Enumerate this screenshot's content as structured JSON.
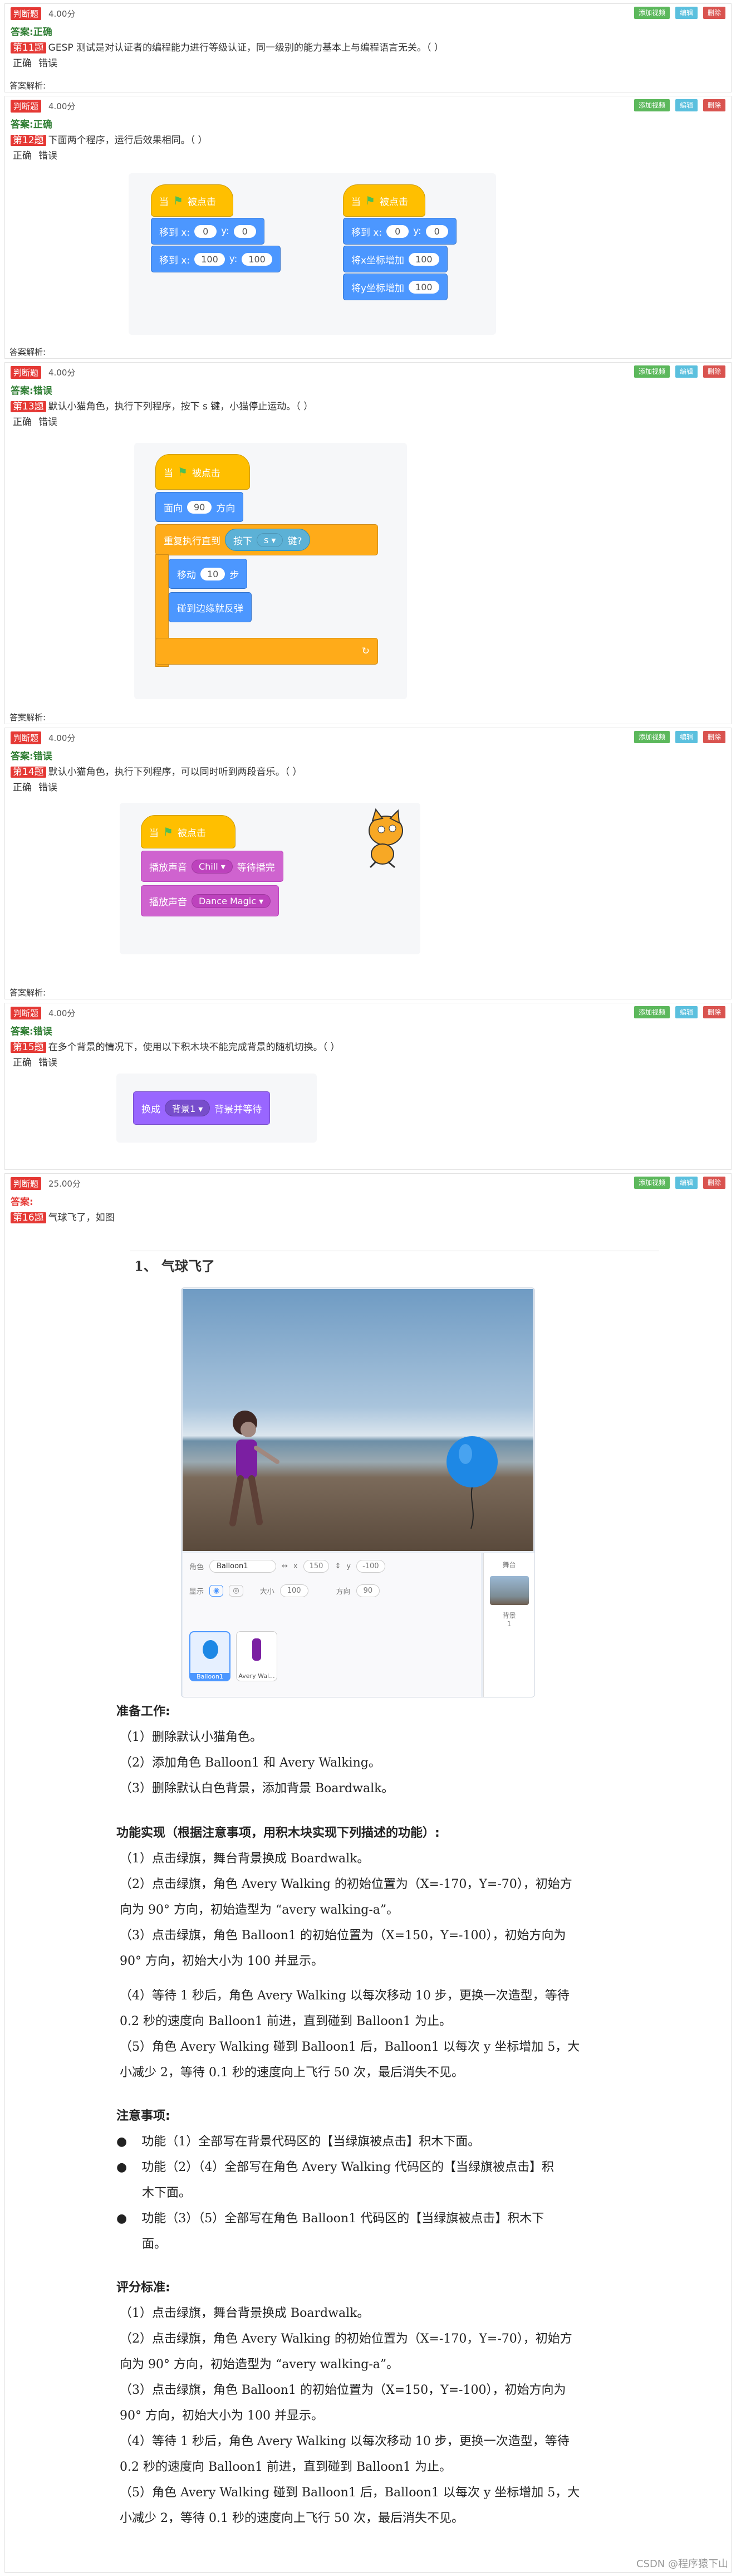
{
  "buttons": {
    "add": "添加视频",
    "edit": "编辑",
    "del": "删除"
  },
  "common": {
    "tag": "判断题",
    "score4": "4.00分",
    "true": "正确",
    "false": "错误",
    "expl": "答案解析:"
  },
  "q11": {
    "answer": "答案:正确",
    "num": "第11题",
    "text": "GESP 测试是对认证者的编程能力进行等级认证，同一级别的能力基本上与编程语言无关。（ ）"
  },
  "q12": {
    "answer": "答案:正确",
    "num": "第12题",
    "text": "下面两个程序，运行后效果相同。（ ）",
    "left": {
      "hat": "当",
      "hat2": "被点击",
      "b1": "移到 x:",
      "b1v": "0",
      "b1y": "y:",
      "b1yv": "0",
      "b2": "移到 x:",
      "b2v": "100",
      "b2y": "y:",
      "b2yv": "100"
    },
    "right": {
      "hat": "当",
      "hat2": "被点击",
      "b1": "移到 x:",
      "b1v": "0",
      "b1y": "y:",
      "b1yv": "0",
      "b2": "将x坐标增加",
      "b2v": "100",
      "b3": "将y坐标增加",
      "b3v": "100"
    }
  },
  "q13": {
    "answer": "答案:错误",
    "num": "第13题",
    "text": "默认小猫角色，执行下列程序，按下 s 键，小猫停止运动。（ ）",
    "hat": "当",
    "hat2": "被点击",
    "face": "面向",
    "faceV": "90",
    "faceT": "方向",
    "rep": "重复执行直到",
    "key": "按下",
    "keyV": "s ▾",
    "keyT": "键?",
    "move": "移动",
    "moveV": "10",
    "moveT": "步",
    "bounce": "碰到边缘就反弹"
  },
  "q14": {
    "answer": "答案:错误",
    "num": "第14题",
    "text": "默认小猫角色，执行下列程序，可以同时听到两段音乐。（ ）",
    "hat": "当",
    "hat2": "被点击",
    "s1": "播放声音",
    "s1v": "Chill ▾",
    "s1t": "等待播完",
    "s2": "播放声音",
    "s2v": "Dance Magic ▾"
  },
  "q15": {
    "answer": "答案:错误",
    "num": "第15题",
    "text": "在多个背景的情况下，使用以下积木块不能完成背景的随机切换。（ ）",
    "b": "换成",
    "bv": "背景1 ▾",
    "bt": "背景并等待"
  },
  "q16": {
    "tag": "判断题",
    "score": "25.00分",
    "answer": "答案:",
    "num": "第16题",
    "text": "气球飞了，如图",
    "title": "1、 气球飞了",
    "sprite": {
      "label": "角色",
      "name": "Balloon1",
      "x": "150",
      "y": "-100",
      "show": "显示",
      "size": "大小",
      "sizeV": "100",
      "dir": "方向",
      "dirV": "90",
      "stage": "舞台",
      "bg": "背景",
      "bgN": "1",
      "s1": "Balloon1",
      "s2": "Avery Wal..."
    },
    "lines": [
      "准备工作:",
      "（1）删除默认小猫角色。",
      "（2）添加角色 Balloon1 和 Avery Walking。",
      "（3）删除默认白色背景，添加背景 Boardwalk。",
      "功能实现（根据注意事项，用积木块实现下列描述的功能）:",
      "（1）点击绿旗，舞台背景换成 Boardwalk。",
      "（2）点击绿旗，角色 Avery Walking 的初始位置为（X=-170，Y=-70），初始方",
      "向为 90° 方向，初始造型为 “avery walking-a”。",
      "（3）点击绿旗，角色 Balloon1 的初始位置为（X=150，Y=-100），初始方向为",
      "90° 方向，初始大小为 100 并显示。",
      "（4）等待 1 秒后，角色 Avery Walking 以每次移动 10 步，更换一次造型，等待",
      "0.2 秒的速度向 Balloon1 前进，直到碰到 Balloon1 为止。",
      "（5）角色 Avery Walking 碰到 Balloon1 后，Balloon1 以每次 y 坐标增加 5，大",
      "小减少 2，等待 0.1 秒的速度向上飞行 50 次，最后消失不见。",
      "注意事项:",
      "功能（1）全部写在背景代码区的【当绿旗被点击】积木下面。",
      "功能（2）（4）全部写在角色 Avery Walking 代码区的【当绿旗被点击】积",
      "木下面。",
      "功能（3）（5）全部写在角色 Balloon1 代码区的【当绿旗被点击】积木下",
      "面。",
      "评分标准:",
      "（1）点击绿旗，舞台背景换成 Boardwalk。",
      "（2）点击绿旗，角色 Avery Walking 的初始位置为（X=-170，Y=-70），初始方",
      "向为 90° 方向，初始造型为 “avery walking-a”。",
      "（3）点击绿旗，角色 Balloon1 的初始位置为（X=150，Y=-100），初始方向为",
      "90° 方向，初始大小为 100 并显示。",
      "（4）等待 1 秒后，角色 Avery Walking 以每次移动 10 步，更换一次造型，等待",
      "0.2 秒的速度向 Balloon1 前进，直到碰到 Balloon1 为止。",
      "（5）角色 Avery Walking 碰到 Balloon1 后，Balloon1 以每次 y 坐标增加 5，大",
      "小减少 2，等待 0.1 秒的速度向上飞行 50 次，最后消失不见。"
    ]
  },
  "watermark": "CSDN @程序猿下山"
}
